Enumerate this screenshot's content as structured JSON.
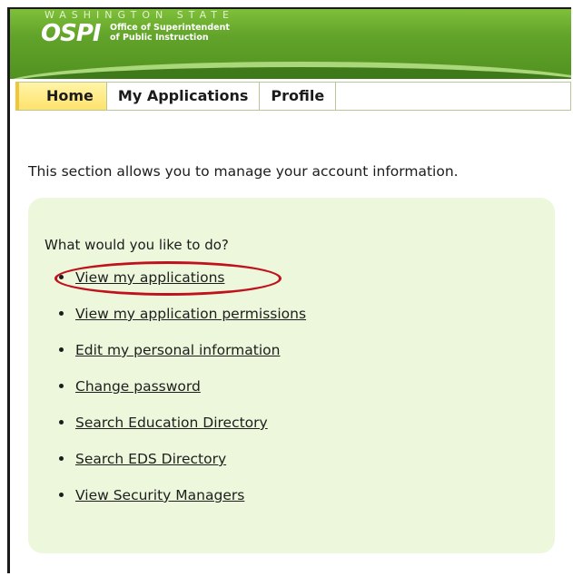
{
  "header": {
    "state_text": "WASHINGTON STATE",
    "logo_text": "OSPI",
    "office_line1": "Office of Superintendent",
    "office_line2": "of Public Instruction"
  },
  "tabs": [
    {
      "label": "Home",
      "active": true
    },
    {
      "label": "My Applications",
      "active": false
    },
    {
      "label": "Profile",
      "active": false
    }
  ],
  "intro": "This section allows you to manage your account information.",
  "panel": {
    "question": "What would you like to do?",
    "links": [
      {
        "label": "View my applications",
        "highlighted": true
      },
      {
        "label": "View my application permissions"
      },
      {
        "label": "Edit my personal information"
      },
      {
        "label": "Change password"
      },
      {
        "label": "Search Education Directory"
      },
      {
        "label": "Search EDS Directory"
      },
      {
        "label": "View Security Managers"
      }
    ]
  },
  "colors": {
    "header_green": "#62a42a",
    "active_tab_yellow": "#ffe26c",
    "panel_bg": "#ecf7dc",
    "highlight_red": "#c0111d"
  }
}
